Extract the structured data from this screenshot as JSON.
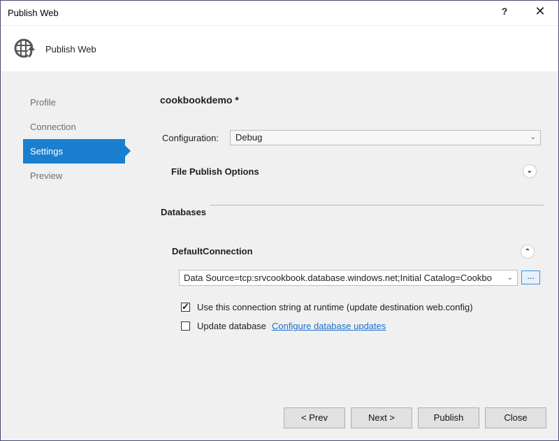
{
  "window": {
    "title": "Publish Web",
    "help_label": "?",
    "close_label": "✕"
  },
  "header": {
    "title": "Publish Web",
    "icon": "globe-publish-icon"
  },
  "nav": {
    "items": [
      {
        "label": "Profile",
        "active": false
      },
      {
        "label": "Connection",
        "active": false
      },
      {
        "label": "Settings",
        "active": true
      },
      {
        "label": "Preview",
        "active": false
      }
    ]
  },
  "settings": {
    "profile_name": "cookbookdemo *",
    "configuration_label": "Configuration:",
    "configuration_value": "Debug",
    "file_publish_options_label": "File Publish Options",
    "file_publish_options_toggle": "expand",
    "databases_label": "Databases",
    "connection_name": "DefaultConnection",
    "connection_toggle": "collapse",
    "connection_string": "Data Source=tcp:srvcookbook.database.windows.net;Initial Catalog=Cookbo",
    "browse_label": "...",
    "use_connection_label": "Use this connection string at runtime (update destination web.config)",
    "use_connection_checked": true,
    "update_database_label": "Update database",
    "update_database_checked": false,
    "configure_link": "Configure database updates"
  },
  "footer": {
    "prev": "< Prev",
    "next": "Next >",
    "publish": "Publish",
    "close": "Close"
  }
}
